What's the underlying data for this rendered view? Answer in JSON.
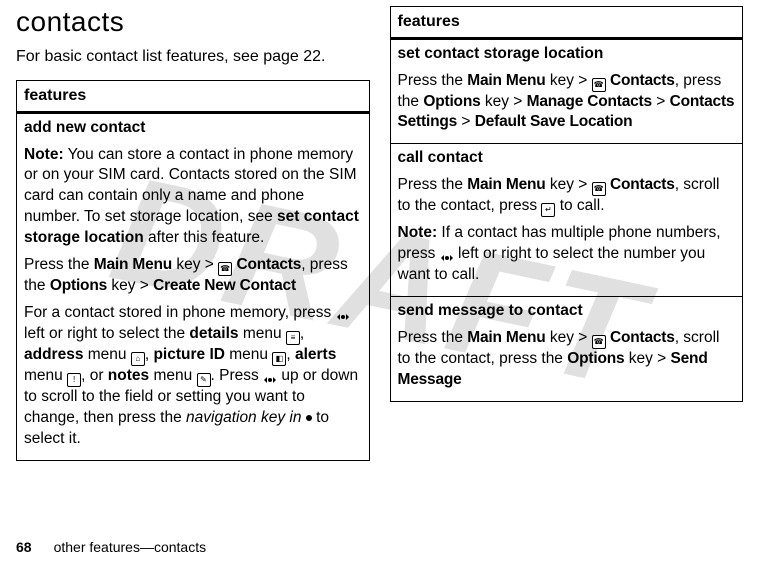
{
  "watermark": "DRAFT",
  "heading": "contacts",
  "intro": "For basic contact list features, see page 22.",
  "footer": {
    "page": "68",
    "text": "other features—contacts"
  },
  "left_table": {
    "header": "features",
    "rows": [
      {
        "title": "add new contact",
        "note_label": "Note:",
        "note_rest": " You can store a contact in phone memory or on your SIM card. Contacts stored on the SIM card can contain only a name and phone number. To set storage location, see ",
        "note_bold": "set contact storage location",
        "note_tail": " after this feature.",
        "press1_a": "Press the ",
        "press1_mm": "Main Menu",
        "press1_b": " key > ",
        "press1_contacts": "Contacts",
        "press1_c": ", press the ",
        "press1_options": "Options",
        "press1_d": " key > ",
        "press1_create": "Create New Contact",
        "para2_a": "For a contact stored in phone memory, press ",
        "para2_b": " left or right to select the ",
        "para2_details": "details",
        "para2_c": " menu ",
        "para2_address": "address",
        "para2_d": " menu ",
        "para2_picture": "picture ID",
        "para2_e": " menu ",
        "para2_alerts": "alerts",
        "para2_f": " menu ",
        "para2_notes": "notes",
        "para2_g": " menu ",
        "para2_h": ". Press ",
        "para2_i": " up or down to scroll to the field or setting you want to change, then press the ",
        "para2_navkey": "navigation key in",
        "para2_j": " to select it."
      }
    ]
  },
  "right_table": {
    "header": "features",
    "rows": [
      {
        "title": "set contact storage location",
        "p1_a": "Press the ",
        "p1_mm": "Main Menu",
        "p1_b": " key > ",
        "p1_contacts": "Contacts",
        "p1_c": ", press the ",
        "p1_options": "Options",
        "p1_d": " key > ",
        "p1_mc": "Manage Contacts",
        "p1_e": " > ",
        "p1_cs": "Contacts Settings",
        "p1_f": " > ",
        "p1_dsl": "Default Save Location"
      },
      {
        "title": "call contact",
        "p1_a": "Press the ",
        "p1_mm": "Main Menu",
        "p1_b": " key > ",
        "p1_contacts": "Contacts",
        "p1_c": ", scroll to the contact, press ",
        "p1_d": " to call.",
        "note_label": "Note:",
        "note_a": " If a contact has multiple phone numbers, press ",
        "note_b": " left or right to select the number you want to call."
      },
      {
        "title": "send message to contact",
        "p1_a": "Press the ",
        "p1_mm": "Main Menu",
        "p1_b": " key > ",
        "p1_contacts": "Contacts",
        "p1_c": ", scroll to the contact, press the ",
        "p1_options": "Options",
        "p1_d": " key > ",
        "p1_sm": "Send Message"
      }
    ]
  }
}
